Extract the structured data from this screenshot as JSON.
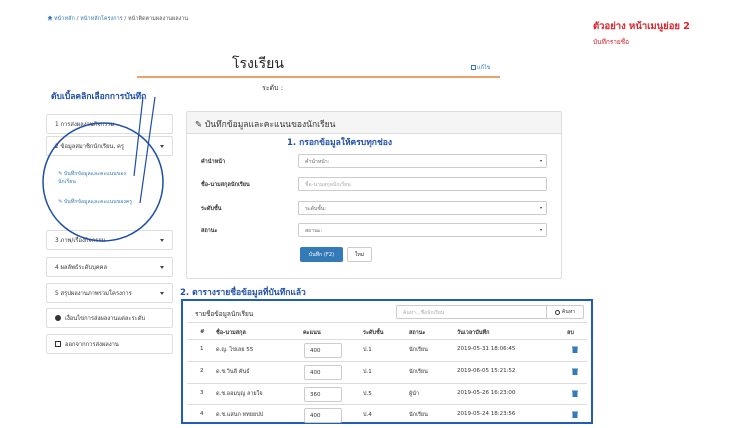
{
  "breadcrumb": {
    "home": "หน้าหลัก",
    "sep1": "/",
    "project": "หน้าหลักโครงการ",
    "sep2": "/",
    "current": "หน้าติดตามผลงานผลงาน"
  },
  "annotations": {
    "example_title": "ตัวอย่าง หน้าเมนูย่อย 2",
    "example_sub": "บันทึกรายชื่อ",
    "double_click": "ดับเบิ้ลคลิกเลือกการบันทึก",
    "step1": "1.  กรอกข้อมูลให้ครบทุกช่อง",
    "step2": "2.  ตารางรายชื่อข้อมูลที่บันทึกแล้ว"
  },
  "page": {
    "title": "โรงเรียน",
    "edit_link": "แก้ไข",
    "level_label": "ระดับ :"
  },
  "sidebar": {
    "items": [
      {
        "label": "1 การส่งผลงานกิจกรรม"
      },
      {
        "label": "2 ข้อมูลสมาชิกนักเรียน, ครู"
      },
      {
        "label": "3 ภาพ/เรื่องกิจกรรม"
      },
      {
        "label": "4 ผลลัพธ์ระดับบุคคล"
      },
      {
        "label": "5 สรุปผลงานภาพรวมโครงการ"
      },
      {
        "label": "เงื่อนไขการส่งผลงานแต่ละระดับ"
      },
      {
        "label": "ออกจากการส่งผลงาน"
      }
    ],
    "sub_items": [
      {
        "label_line1": "บันทึกข้อมูลและคะแนนของ",
        "label_line2": "นักเรียน"
      },
      {
        "label_line1": "บันทึกข้อมูลและคะแนนของครู",
        "label_line2": ""
      }
    ]
  },
  "form": {
    "panel_title": "บันทึกข้อมูลและคะแนนของนักเรียน",
    "fields": [
      {
        "label": "คำนำหน้า",
        "value": "คำนำหน้า:"
      },
      {
        "label": "ชื่อ-นามสกุลนักเรียน",
        "placeholder": "ชื่อ-นามสกุลนักเรียน"
      },
      {
        "label": "ระดับชั้น",
        "value": "ระดับชั้น:"
      },
      {
        "label": "สถานะ",
        "value": "สถานะ:"
      }
    ],
    "save_label": "บันทึก (F2)",
    "clear_label": "ใหม่"
  },
  "table": {
    "title": "รายชื่อข้อมูลนักเรียน",
    "search_placeholder": "ค้นหา...ชื่อนักเรียน",
    "search_label": "ค้นหา",
    "columns": [
      "#",
      "ชื่อ-นามสกุล",
      "คะแนน",
      "ระดับชั้น",
      "สถานะ",
      "วันเวลาบันทึก",
      "ลบ"
    ],
    "rows": [
      {
        "num": "1",
        "name": "ด.ญ. ไข่เลย 55",
        "score": "400",
        "level": "ป.1",
        "status": "นักเรียน",
        "date": "2019-05-31 18:06:45"
      },
      {
        "num": "2",
        "name": "ด.ช.วินลี คันธ์",
        "score": "400",
        "level": "ป.1",
        "status": "นักเรียน",
        "date": "2019-06-05 15:21:52"
      },
      {
        "num": "3",
        "name": "ด.ช.ออมบุญ ลายใจ",
        "score": "360",
        "level": "ป.5",
        "status": "ผู้นำ",
        "date": "2019-05-26 16:23:00"
      },
      {
        "num": "4",
        "name": "ด.ช.แสนก หทยยปป",
        "score": "400",
        "level": "ป.4",
        "status": "นักเรียน",
        "date": "2019-05-24 18:23:56"
      }
    ]
  },
  "colors": {
    "annotation_red": "#d9242a",
    "annotation_blue": "#1f4ea8",
    "primary": "#337ab7",
    "title_underline": "#e8a26a"
  }
}
